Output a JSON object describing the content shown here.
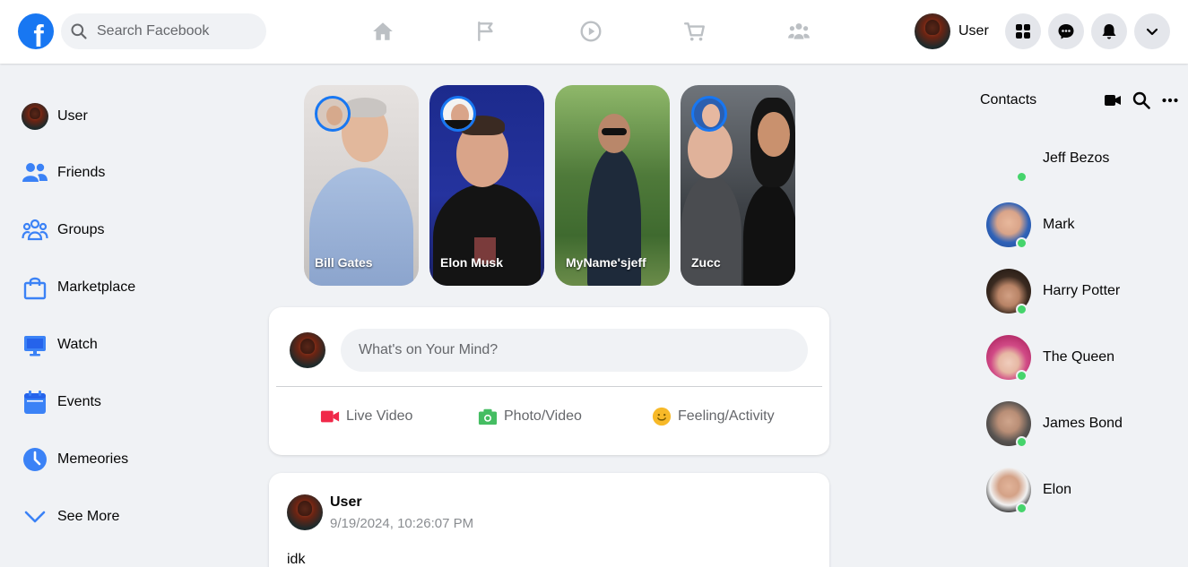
{
  "app": {
    "name": "Facebook"
  },
  "search": {
    "placeholder": "Search Facebook"
  },
  "topbar": {
    "user_label": "User"
  },
  "sidebar": {
    "items": [
      {
        "label": "User",
        "icon": "user-avatar"
      },
      {
        "label": "Friends",
        "icon": "friends-icon"
      },
      {
        "label": "Groups",
        "icon": "groups-icon"
      },
      {
        "label": "Marketplace",
        "icon": "marketplace-icon"
      },
      {
        "label": "Watch",
        "icon": "watch-icon"
      },
      {
        "label": "Events",
        "icon": "events-icon"
      },
      {
        "label": "Memeories",
        "icon": "memories-icon"
      },
      {
        "label": "See More",
        "icon": "chevron-down-icon"
      }
    ]
  },
  "stories": [
    {
      "name": "Bill Gates"
    },
    {
      "name": "Elon Musk"
    },
    {
      "name": "MyName'sjeff"
    },
    {
      "name": "Zucc"
    }
  ],
  "composer": {
    "placeholder": "What's on Your Mind?",
    "actions": [
      {
        "label": "Live Video",
        "icon": "live-video-icon",
        "color": "#f02849"
      },
      {
        "label": "Photo/Video",
        "icon": "photo-icon",
        "color": "#45bd62"
      },
      {
        "label": "Feeling/Activity",
        "icon": "feeling-icon",
        "color": "#f7b928"
      }
    ]
  },
  "post": {
    "author": "User",
    "timestamp": "9/19/2024, 10:26:07 PM",
    "text": "idk"
  },
  "contacts": {
    "title": "Contacts",
    "items": [
      {
        "name": "Jeff Bezos",
        "online": true
      },
      {
        "name": "Mark",
        "online": true
      },
      {
        "name": "Harry Potter",
        "online": true
      },
      {
        "name": "The Queen",
        "online": true
      },
      {
        "name": "James Bond",
        "online": true
      },
      {
        "name": "Elon",
        "online": true
      }
    ]
  },
  "colors": {
    "brand": "#1877f2",
    "background": "#f0f2f5",
    "online": "#45d46b",
    "nav_icon": "#bcc0c4"
  }
}
